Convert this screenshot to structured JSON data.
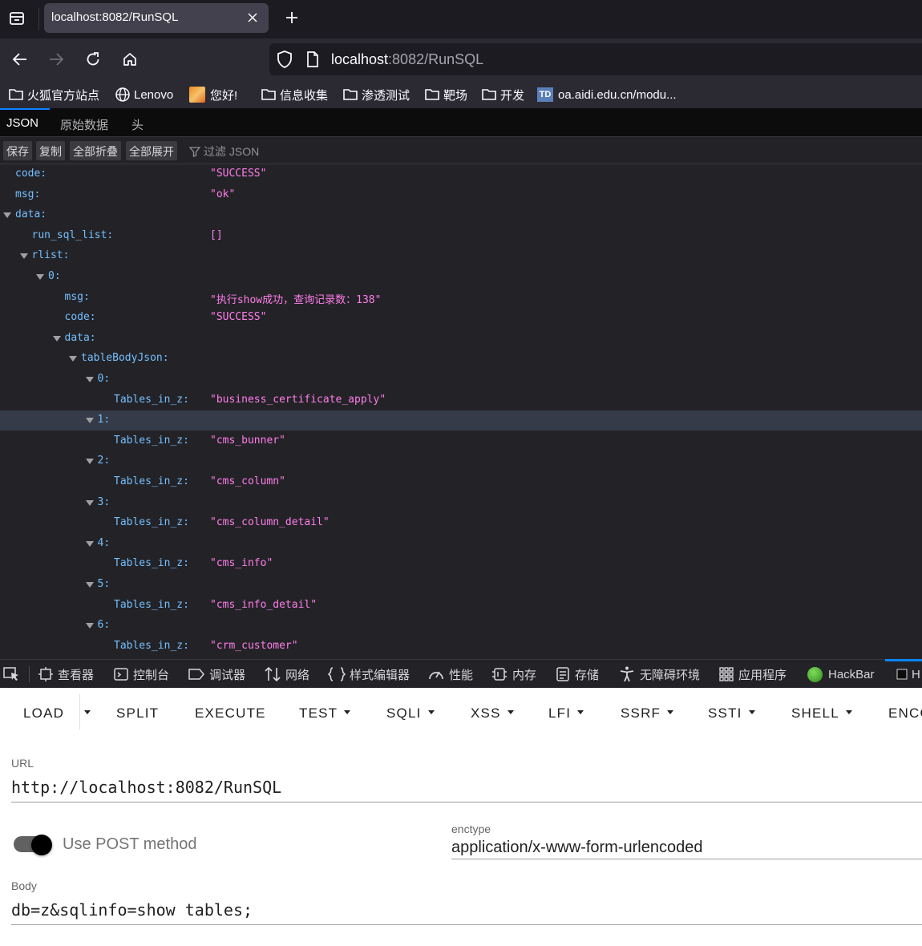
{
  "browser": {
    "tab_title": "localhost:8082/RunSQL",
    "url_host": "localhost",
    "url_rest": ":8082/RunSQL"
  },
  "bookmarks": [
    {
      "label": "火狐官方站点",
      "icon": "folder-icon"
    },
    {
      "label": "Lenovo",
      "icon": "globe-icon"
    },
    {
      "label": "您好!",
      "icon": "favicon"
    },
    {
      "label": "信息收集",
      "icon": "folder-icon"
    },
    {
      "label": "渗透测试",
      "icon": "folder-icon"
    },
    {
      "label": "靶场",
      "icon": "folder-icon"
    },
    {
      "label": "开发",
      "icon": "folder-icon"
    },
    {
      "label": "oa.aidi.edu.cn/modu...",
      "icon": "td-favicon",
      "favicon_text": "TD"
    }
  ],
  "viewer": {
    "tabs": [
      "JSON",
      "原始数据",
      "头"
    ],
    "toolbar": [
      "保存",
      "复制",
      "全部折叠",
      "全部展开"
    ],
    "filter_placeholder": "过滤 JSON"
  },
  "json_rows": [
    {
      "key": "code:",
      "value": "\"SUCCESS\"",
      "depth": 0,
      "expanded": null
    },
    {
      "key": "msg:",
      "value": "\"ok\"",
      "depth": 0,
      "expanded": null
    },
    {
      "key": "data:",
      "value": "",
      "depth": 0,
      "expanded": true
    },
    {
      "key": "run_sql_list:",
      "value": "[]",
      "depth": 1,
      "expanded": null
    },
    {
      "key": "rlist:",
      "value": "",
      "depth": 1,
      "expanded": true
    },
    {
      "key": "0:",
      "value": "",
      "depth": 2,
      "expanded": true
    },
    {
      "key": "msg:",
      "value": "\"执行show成功，查询记录数：138\"",
      "depth": 3,
      "expanded": null
    },
    {
      "key": "code:",
      "value": "\"SUCCESS\"",
      "depth": 3,
      "expanded": null
    },
    {
      "key": "data:",
      "value": "",
      "depth": 3,
      "expanded": true
    },
    {
      "key": "tableBodyJson:",
      "value": "",
      "depth": 4,
      "expanded": true
    },
    {
      "key": "0:",
      "value": "",
      "depth": 5,
      "expanded": true
    },
    {
      "key": "Tables_in_z:",
      "value": "\"business_certificate_apply\"",
      "depth": 6,
      "expanded": null
    },
    {
      "key": "1:",
      "value": "",
      "depth": 5,
      "expanded": true,
      "highlight": true
    },
    {
      "key": "Tables_in_z:",
      "value": "\"cms_bunner\"",
      "depth": 6,
      "expanded": null
    },
    {
      "key": "2:",
      "value": "",
      "depth": 5,
      "expanded": true
    },
    {
      "key": "Tables_in_z:",
      "value": "\"cms_column\"",
      "depth": 6,
      "expanded": null
    },
    {
      "key": "3:",
      "value": "",
      "depth": 5,
      "expanded": true
    },
    {
      "key": "Tables_in_z:",
      "value": "\"cms_column_detail\"",
      "depth": 6,
      "expanded": null
    },
    {
      "key": "4:",
      "value": "",
      "depth": 5,
      "expanded": true
    },
    {
      "key": "Tables_in_z:",
      "value": "\"cms_info\"",
      "depth": 6,
      "expanded": null
    },
    {
      "key": "5:",
      "value": "",
      "depth": 5,
      "expanded": true
    },
    {
      "key": "Tables_in_z:",
      "value": "\"cms_info_detail\"",
      "depth": 6,
      "expanded": null
    },
    {
      "key": "6:",
      "value": "",
      "depth": 5,
      "expanded": true
    },
    {
      "key": "Tables_in_z:",
      "value": "\"crm_customer\"",
      "depth": 6,
      "expanded": null
    }
  ],
  "devtools_tabs": [
    {
      "label": "查看器",
      "icon": "inspector-icon"
    },
    {
      "label": "控制台",
      "icon": "console-icon"
    },
    {
      "label": "调试器",
      "icon": "debugger-icon"
    },
    {
      "label": "网络",
      "icon": "network-icon"
    },
    {
      "label": "样式编辑器",
      "icon": "style-editor-icon"
    },
    {
      "label": "性能",
      "icon": "performance-icon"
    },
    {
      "label": "内存",
      "icon": "memory-icon"
    },
    {
      "label": "存储",
      "icon": "storage-icon"
    },
    {
      "label": "无障碍环境",
      "icon": "accessibility-icon"
    },
    {
      "label": "应用程序",
      "icon": "application-icon"
    },
    {
      "label": "HackBar",
      "icon": "hackbar-icon"
    },
    {
      "label": "H",
      "icon": "extension-icon"
    }
  ],
  "hackbar": {
    "menu": [
      "LOAD",
      "SPLIT",
      "EXECUTE",
      "TEST",
      "SQLI",
      "XSS",
      "LFI",
      "SSRF",
      "SSTI",
      "SHELL",
      "ENCO"
    ],
    "url_label": "URL",
    "url_value": "http://localhost:8082/RunSQL",
    "post_label": "Use POST method",
    "post_enabled": true,
    "enctype_label": "enctype",
    "enctype_value": "application/x-www-form-urlencoded",
    "body_label": "Body",
    "body_value": "db=z&sqlinfo=show tables;"
  }
}
